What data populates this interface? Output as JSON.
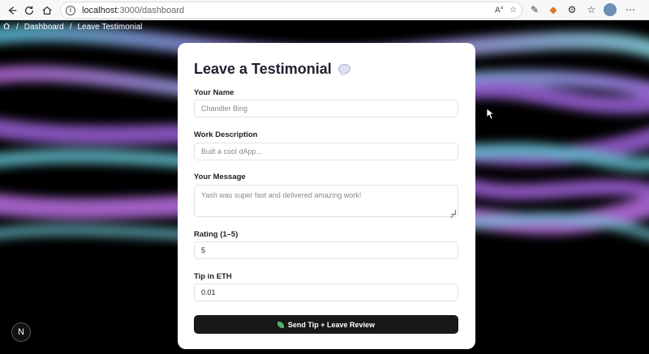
{
  "browser": {
    "url_host": "localhost",
    "url_path": ":3000/dashboard",
    "icons": [
      "back-icon",
      "reload-icon",
      "home-icon",
      "info-icon",
      "read-aloud-icon",
      "favorite-icon",
      "extension-icon",
      "profile-avatar",
      "more-icon"
    ]
  },
  "breadcrumb": {
    "items": [
      "Dashboard",
      "Leave Testimonial"
    ],
    "separator": "/"
  },
  "form": {
    "title": "Leave a Testimonial",
    "name_label": "Your Name",
    "name_placeholder": "Chandler Bing",
    "work_label": "Work Description",
    "work_placeholder": "Built a cool dApp...",
    "message_label": "Your Message",
    "message_placeholder": "Yash was super fast and delivered amazing work!",
    "rating_label": "Rating (1–5)",
    "rating_value": "5",
    "tip_label": "Tip in ETH",
    "tip_value": "0.01",
    "submit_label": "Send Tip + Leave Review"
  },
  "badge": {
    "letter": "N"
  },
  "colors": {
    "accent_dark": "#18181b",
    "wave_purple": "#a86bd8",
    "wave_teal": "#4fb3c4"
  }
}
